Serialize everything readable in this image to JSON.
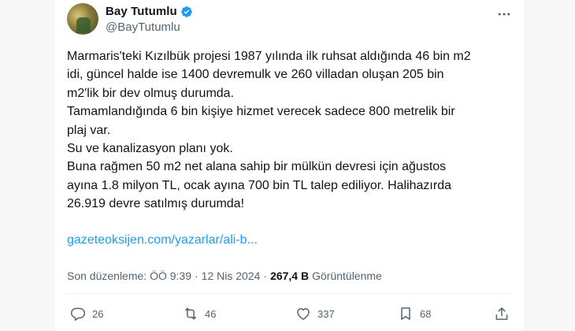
{
  "author": {
    "display_name": "Bay Tutumlu",
    "handle": "@BayTutumlu"
  },
  "tweet": {
    "lines": [
      "Marmaris'teki Kızılbük projesi 1987 yılında ilk ruhsat aldığında 46 bin m2",
      "idi, güncel halde ise 1400 devremulk ve 260 villadan oluşan 205 bin",
      "m2'lik bir dev olmuş durumda.",
      "Tamamlandığında 6 bin kişiye hizmet verecek sadece 800 metrelik bir",
      "plaj var.",
      "Su ve kanalizasyon planı yok.",
      "Buna rağmen 50 m2 net alana sahip bir mülkün devresi için ağustos",
      "ayına 1.8 milyon TL, ocak ayına 700 bin TL talep ediliyor. Halihazırda",
      "26.919 devre satılmış durumda!"
    ],
    "link_text": "gazeteoksijen.com/yazarlar/ali-b..."
  },
  "meta": {
    "edited_label": "Son düzenleme: ÖÖ 9:39",
    "separator": "·",
    "date": "12 Nis 2024",
    "views_count": "267,4 B",
    "views_label": "Görüntülenme"
  },
  "actions": {
    "replies": "26",
    "reposts": "46",
    "likes": "337",
    "bookmarks": "68"
  },
  "colors": {
    "verified": "#1d9bf0",
    "link": "#1d9bf0",
    "muted": "#536471"
  }
}
